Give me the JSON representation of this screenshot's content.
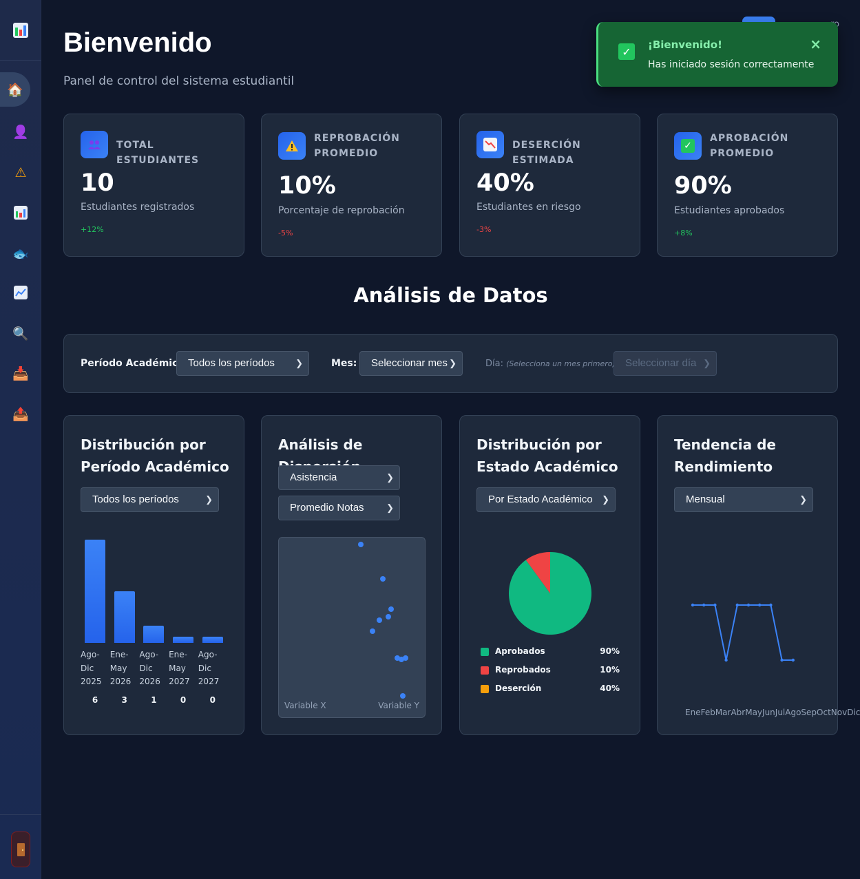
{
  "sidebar": {
    "items": [
      {
        "name": "sidebar-item-home",
        "icon": "home-icon",
        "glyph": "🏠"
      },
      {
        "name": "sidebar-item-students",
        "icon": "user-icon",
        "glyph": "👤"
      },
      {
        "name": "sidebar-item-alerts",
        "icon": "warning-icon",
        "glyph": "⚠"
      },
      {
        "name": "sidebar-item-reports",
        "icon": "bar-chart-icon",
        "glyph": ""
      },
      {
        "name": "sidebar-item-fish",
        "icon": "fish-icon",
        "glyph": "🐟"
      },
      {
        "name": "sidebar-item-trends",
        "icon": "line-chart-icon",
        "glyph": "📈"
      },
      {
        "name": "sidebar-item-search",
        "icon": "search-icon",
        "glyph": "🔍"
      },
      {
        "name": "sidebar-item-import",
        "icon": "inbox-in-icon",
        "glyph": "📥"
      },
      {
        "name": "sidebar-item-export",
        "icon": "inbox-out-icon",
        "glyph": "📤"
      }
    ]
  },
  "header": {
    "title": "Bienvenido",
    "subtitle": "Panel de control del sistema estudiantil",
    "user_fragment": "ro"
  },
  "toast": {
    "title": "¡Bienvenido!",
    "message": "Has iniciado sesión correctamente",
    "close": "×",
    "check": "✓"
  },
  "stats": [
    {
      "label": "Total Estudiantes",
      "value": "10",
      "desc": "Estudiantes registrados",
      "change": "+12%",
      "icon": "people-icon"
    },
    {
      "label": "Reprobación Promedio",
      "value": "10%",
      "desc": "Porcentaje de reprobación",
      "change": "-5%",
      "icon": "warning-icon"
    },
    {
      "label": "Deserción Estimada",
      "value": "40%",
      "desc": "Estudiantes en riesgo",
      "change": "-3%",
      "icon": "chart-down-icon"
    },
    {
      "label": "Aprobación Promedio",
      "value": "90%",
      "desc": "Estudiantes aprobados",
      "change": "+8%",
      "icon": "check-icon"
    }
  ],
  "section_title": "Análisis de Datos",
  "filters": {
    "period_label": "Período Académico:",
    "period_value": "Todos los períodos",
    "month_label": "Mes:",
    "month_value": "Seleccionar mes",
    "day_label": "Día:",
    "day_hint": "(Selecciona un mes primero)",
    "day_value": "Seleccionar día"
  },
  "charts": {
    "period": {
      "title": "Distribución por Período Académico",
      "select": "Todos los períodos"
    },
    "scatter": {
      "title": "Análisis de Dispersión",
      "select_x": "Asistencia",
      "select_y": "Promedio Notas",
      "xlabel": "Variable X",
      "ylabel": "Variable Y"
    },
    "status": {
      "title": "Distribución por Estado Académico",
      "select": "Por Estado Académico"
    },
    "trend": {
      "title": "Tendencia de Rendimiento",
      "select": "Mensual",
      "months_text": "EneFebMarAbrMayJunJulAgoSepOctNovDic"
    }
  },
  "chart_data": [
    {
      "type": "bar",
      "title": "Distribución por Período Académico",
      "categories": [
        "Ago-Dic 2025",
        "Ene-May 2026",
        "Ago-Dic 2026",
        "Ene-May 2027",
        "Ago-Dic 2027"
      ],
      "category_lines": [
        [
          "Ago-",
          "Dic",
          "2025"
        ],
        [
          "Ene-",
          "May",
          "2026"
        ],
        [
          "Ago-",
          "Dic",
          "2026"
        ],
        [
          "Ene-",
          "May",
          "2027"
        ],
        [
          "Ago-",
          "Dic",
          "2027"
        ]
      ],
      "values": [
        6,
        3,
        1,
        0,
        0
      ],
      "color": "#3b82f6"
    },
    {
      "type": "scatter",
      "title": "Análisis de Dispersión",
      "xlabel": "Variable X",
      "ylabel": "Variable Y",
      "points": [
        [
          56,
          96
        ],
        [
          71,
          77
        ],
        [
          77,
          60
        ],
        [
          75,
          56
        ],
        [
          69,
          54
        ],
        [
          64,
          48
        ],
        [
          81,
          33
        ],
        [
          84,
          32
        ],
        [
          87,
          33
        ],
        [
          85,
          12
        ]
      ],
      "xlim": [
        0,
        100
      ],
      "ylim": [
        0,
        100
      ],
      "color": "#3b82f6"
    },
    {
      "type": "pie",
      "title": "Distribución por Estado Académico",
      "slices": [
        {
          "name": "Aprobados",
          "value": 90,
          "color": "#10b981"
        },
        {
          "name": "Reprobados",
          "value": 10,
          "color": "#ef4444"
        }
      ],
      "legend": [
        {
          "name": "Aprobados",
          "pct": "90%",
          "color": "#10b981"
        },
        {
          "name": "Reprobados",
          "pct": "10%",
          "color": "#ef4444"
        },
        {
          "name": "Deserción",
          "pct": "40%",
          "color": "#f59e0b"
        }
      ]
    },
    {
      "type": "line",
      "title": "Tendencia de Rendimiento",
      "categories": [
        "Ene",
        "Feb",
        "Mar",
        "Abr",
        "May",
        "Jun",
        "Jul",
        "Ago",
        "Sep",
        "Oct",
        "Nov",
        "Dic"
      ],
      "values": [
        90,
        90,
        90,
        0,
        90,
        90,
        90,
        90,
        0,
        0,
        null,
        null
      ],
      "ylim": [
        0,
        90
      ],
      "color": "#3b82f6"
    }
  ]
}
